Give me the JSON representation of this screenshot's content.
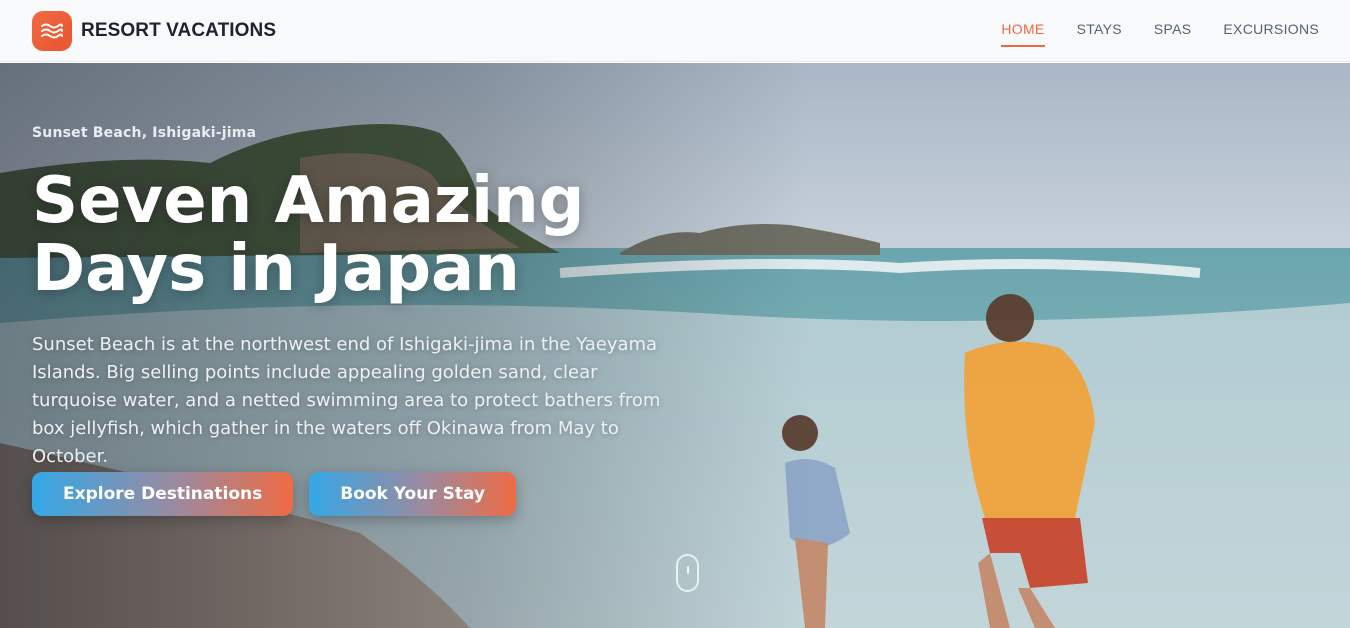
{
  "brand": {
    "name": "RESORT VACATIONS",
    "logo_icon": "waves-icon",
    "accent": "#EE6A43"
  },
  "nav": {
    "items": [
      {
        "label": "HOME",
        "active": true
      },
      {
        "label": "STAYS",
        "active": false
      },
      {
        "label": "SPAS",
        "active": false
      },
      {
        "label": "EXCURSIONS",
        "active": false
      }
    ]
  },
  "hero": {
    "location": "Sunset Beach, Ishigaki-jima",
    "title": "Seven Amazing Days in Japan",
    "description": "Sunset Beach is at the northwest end of Ishigaki-jima in the Yaeyama Islands. Big selling points include appealing golden sand, clear turquoise water, and a netted swimming area to protect bathers from box jellyfish, which gather in the waters off Okinawa from May to October.",
    "buttons": [
      {
        "label": "Explore Destinations"
      },
      {
        "label": "Book Your Stay"
      }
    ],
    "scroll_icon": "mouse-scroll-icon"
  }
}
